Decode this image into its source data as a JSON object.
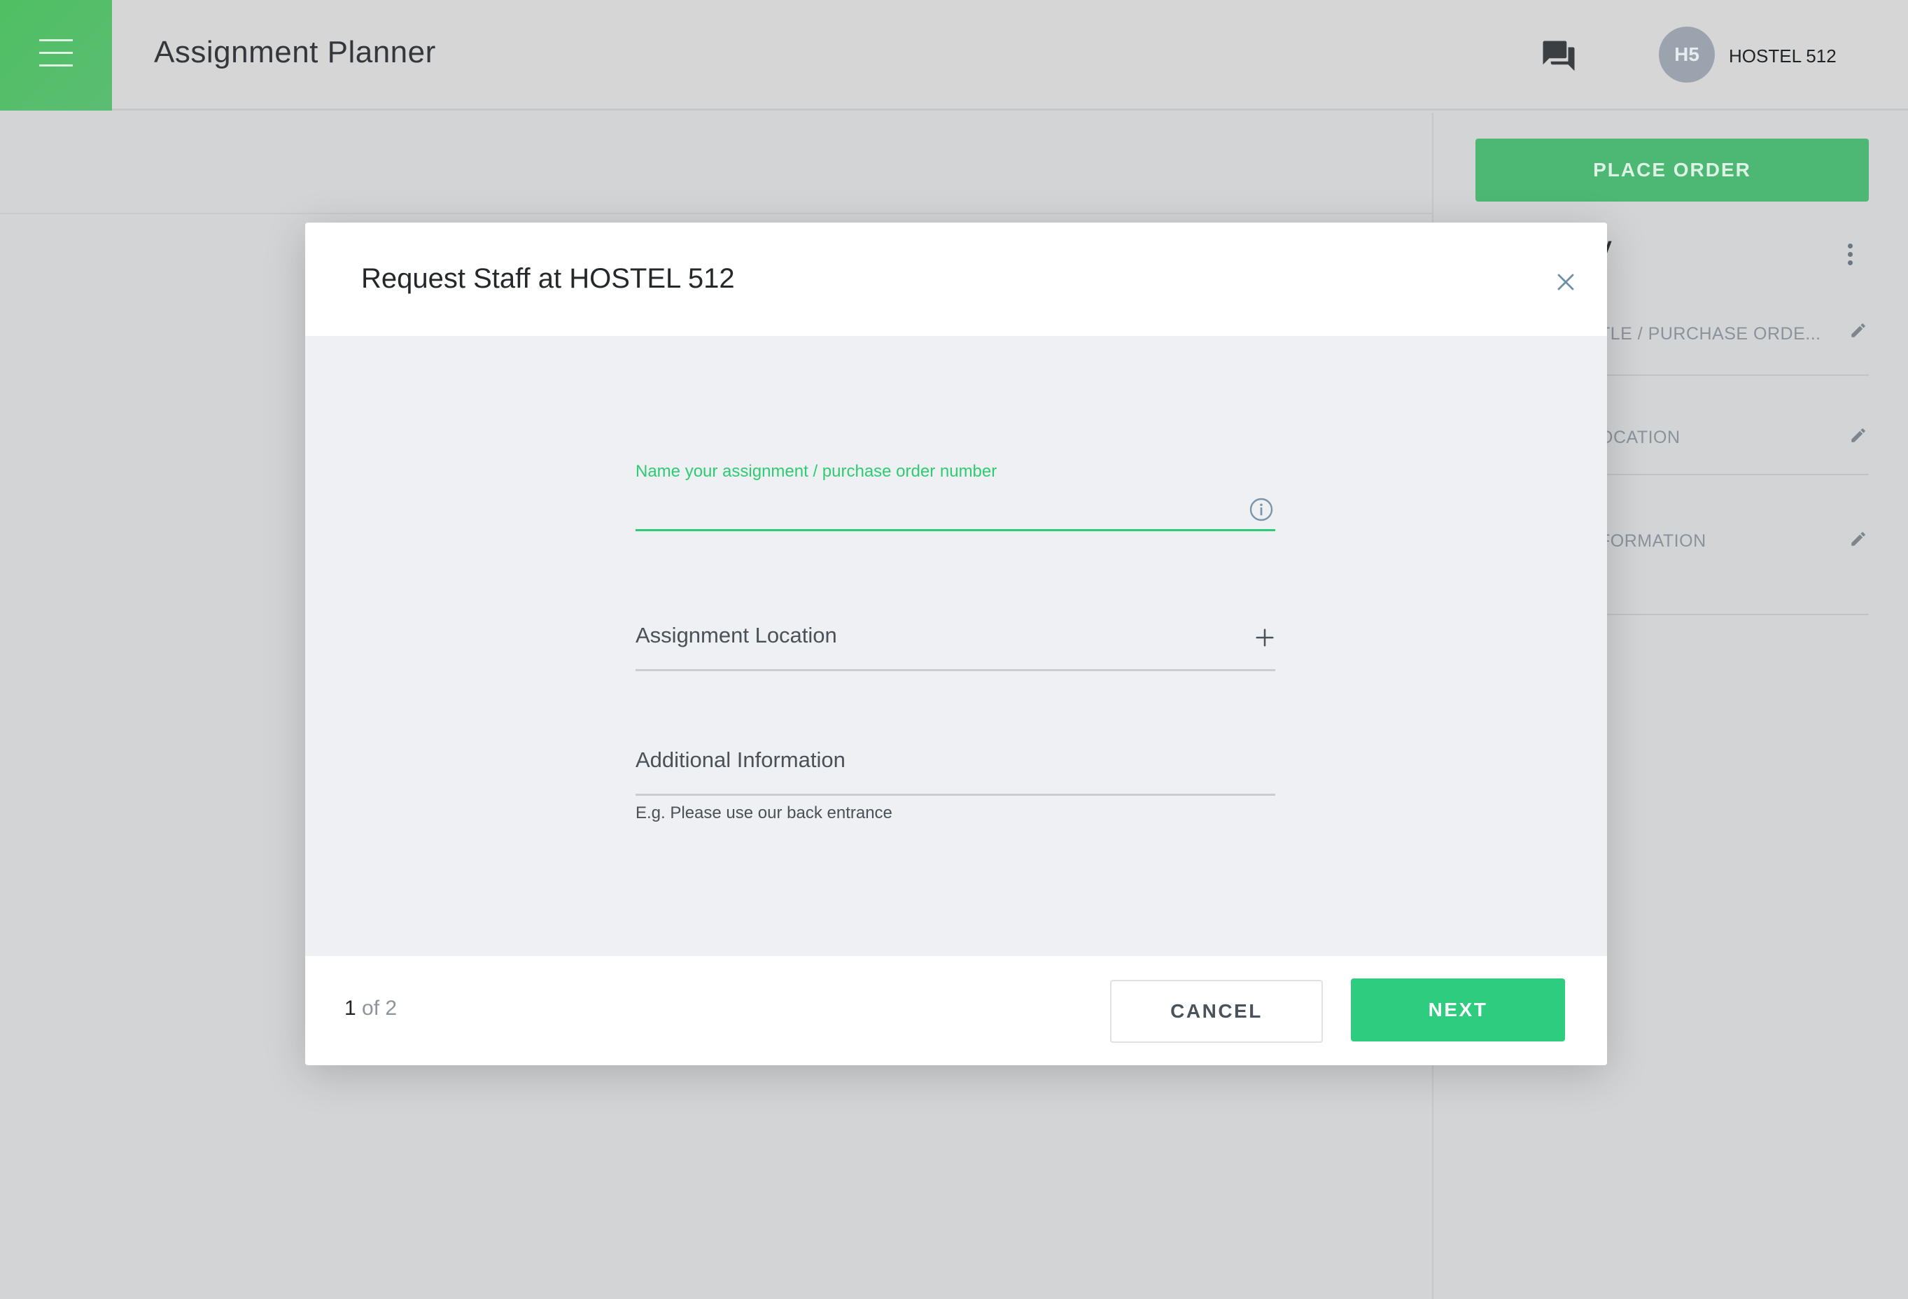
{
  "header": {
    "app_title": "Assignment Planner",
    "avatar_initials": "H5",
    "user_name": "HOSTEL 512"
  },
  "sidebar_panel": {
    "place_order_label": "PLACE ORDER",
    "summary_title_visible": "mmary",
    "rows": [
      {
        "label": "TLE / PURCHASE ORDE..."
      },
      {
        "label": "OCATION"
      },
      {
        "label": "FORMATION"
      }
    ]
  },
  "modal": {
    "title": "Request Staff at HOSTEL 512",
    "fields": {
      "assignment_name": {
        "label": "Name your assignment / purchase order number",
        "value": ""
      },
      "location": {
        "label": "Assignment Location"
      },
      "additional_info": {
        "label": "Additional Information",
        "helper": "E.g. Please use our back entrance"
      }
    },
    "footer": {
      "current_page": "1",
      "of_text": " of 2",
      "cancel_label": "CANCEL",
      "next_label": "NEXT"
    }
  },
  "colors": {
    "accent_green": "#2ecc71",
    "menu_green": "#4fbf63",
    "place_order_green": "#4cb874"
  },
  "icons": [
    "menu-icon",
    "chat-icon",
    "close-icon",
    "info-icon",
    "plus-icon",
    "pencil-icon",
    "kebab-icon"
  ]
}
